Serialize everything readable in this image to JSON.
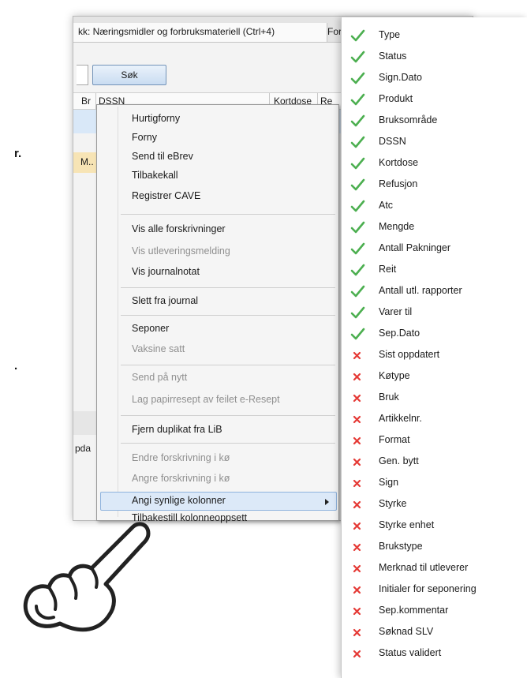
{
  "doc_fragments": [
    "r.",
    "."
  ],
  "window": {
    "active_tab": "kk: Næringsmidler og forbruksmateriell (Ctrl+4)",
    "next_tab": "For",
    "search_button": "Søk",
    "columns": [
      "Br",
      "DSSN",
      "Kortdose",
      "Re"
    ],
    "row_cell": "M..",
    "cut_text": "pda"
  },
  "context_menu": {
    "items": [
      {
        "label": "Hurtigforny",
        "enabled": true
      },
      {
        "label": "Forny",
        "enabled": true
      },
      {
        "label": "Send til eBrev",
        "enabled": true
      },
      {
        "label": "Tilbakekall",
        "enabled": true
      },
      {
        "label": "Registrer CAVE",
        "enabled": true
      },
      {
        "label": "Vis alle forskrivninger",
        "enabled": true
      },
      {
        "label": "Vis utleveringsmelding",
        "enabled": false
      },
      {
        "label": "Vis journalnotat",
        "enabled": true
      },
      {
        "label": "Slett fra journal",
        "enabled": true
      },
      {
        "label": "Seponer",
        "enabled": true
      },
      {
        "label": "Vaksine satt",
        "enabled": false
      },
      {
        "label": "Send på nytt",
        "enabled": false
      },
      {
        "label": "Lag papirresept av feilet e-Resept",
        "enabled": false
      },
      {
        "label": "Fjern duplikat fra LiB",
        "enabled": true
      },
      {
        "label": "Endre forskrivning i kø",
        "enabled": false
      },
      {
        "label": "Angre forskrivning i kø",
        "enabled": false
      },
      {
        "label": "Angi synlige kolonner",
        "enabled": true,
        "submenu": true,
        "highlighted": true
      },
      {
        "label": "Tilbakestill kolonneoppsett",
        "enabled": true
      }
    ]
  },
  "column_chooser": {
    "visible_color": "#4caf50",
    "hidden_color": "#e53935",
    "items": [
      {
        "label": "Type",
        "visible": true
      },
      {
        "label": "Status",
        "visible": true
      },
      {
        "label": "Sign.Dato",
        "visible": true
      },
      {
        "label": "Produkt",
        "visible": true
      },
      {
        "label": "Bruksområde",
        "visible": true
      },
      {
        "label": "DSSN",
        "visible": true
      },
      {
        "label": "Kortdose",
        "visible": true
      },
      {
        "label": "Refusjon",
        "visible": true
      },
      {
        "label": "Atc",
        "visible": true
      },
      {
        "label": "Mengde",
        "visible": true
      },
      {
        "label": "Antall Pakninger",
        "visible": true
      },
      {
        "label": "Reit",
        "visible": true
      },
      {
        "label": "Antall utl. rapporter",
        "visible": true
      },
      {
        "label": "Varer til",
        "visible": true
      },
      {
        "label": "Sep.Dato",
        "visible": true
      },
      {
        "label": "Sist oppdatert",
        "visible": false
      },
      {
        "label": "Køtype",
        "visible": false
      },
      {
        "label": "Bruk",
        "visible": false
      },
      {
        "label": "Artikkelnr.",
        "visible": false
      },
      {
        "label": "Format",
        "visible": false
      },
      {
        "label": "Gen. bytt",
        "visible": false
      },
      {
        "label": "Sign",
        "visible": false
      },
      {
        "label": "Styrke",
        "visible": false
      },
      {
        "label": "Styrke enhet",
        "visible": false
      },
      {
        "label": "Brukstype",
        "visible": false
      },
      {
        "label": "Merknad til utleverer",
        "visible": false
      },
      {
        "label": "Initialer for seponering",
        "visible": false
      },
      {
        "label": "Sep.kommentar",
        "visible": false
      },
      {
        "label": "Søknad SLV",
        "visible": false
      },
      {
        "label": "Status validert",
        "visible": false
      }
    ]
  }
}
